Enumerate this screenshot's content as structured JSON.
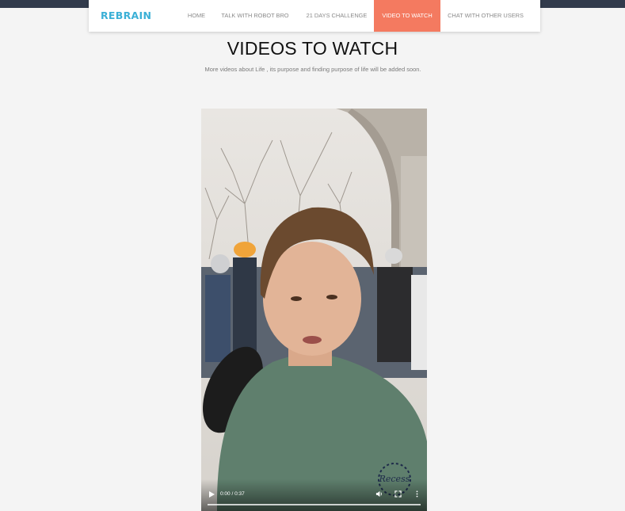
{
  "navbar": {
    "brand": "REBRAIN",
    "items": [
      {
        "label": "HOME",
        "active": false
      },
      {
        "label": "TALK WITH ROBOT BRO",
        "active": false
      },
      {
        "label": "21 DAYS CHALLENGE",
        "active": false
      },
      {
        "label": "VIDEO TO WATCH",
        "active": true
      },
      {
        "label": "CHAT WITH OTHER USERS",
        "active": false
      }
    ]
  },
  "main": {
    "title": "VIDEOS TO WATCH",
    "subtitle": "More videos about Life , its purpose and finding purpose of life will be added soon."
  },
  "video": {
    "time": "0:00 / 0:37",
    "progress": 0,
    "watermark_text": "Recess"
  },
  "colors": {
    "accent": "#f47a60",
    "brand": "#3bb0d6",
    "topbar": "#323b4c",
    "background": "#f4f4f4"
  },
  "icons": [
    "play-icon",
    "volume-icon",
    "fullscreen-icon",
    "more-options-icon"
  ]
}
